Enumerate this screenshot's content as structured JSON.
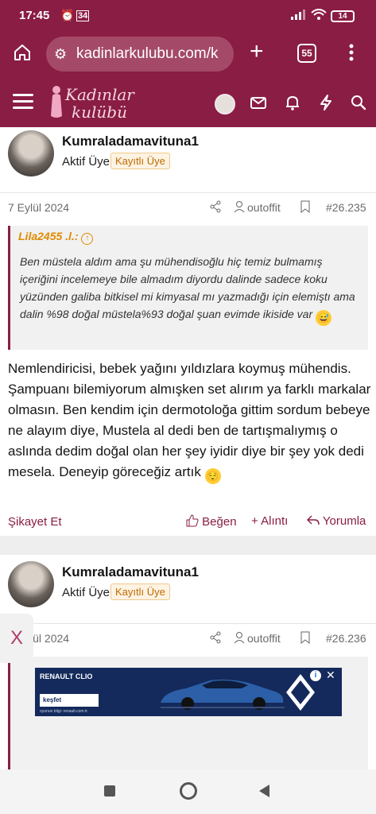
{
  "status_bar": {
    "time": "17:45",
    "battery": "14"
  },
  "browser": {
    "url": "kadinlarkulubu.com/k",
    "tab_count": "55"
  },
  "site": {
    "logo_line1": "Kadınlar",
    "logo_line2": "kulübü"
  },
  "posts": [
    {
      "username": "Kumraladamavituna1",
      "role": "Aktif Üye",
      "badge": "Kayıtlı Üye",
      "date": "7 Eylül 2024",
      "author_link": "outoffit",
      "post_number": "#26.235",
      "quote_author": "Lila2455 .l.:",
      "quote_text": "Ben müstela aldım ama şu mühendisoğlu hiç temiz bulmamış içeriğini incelemeye bile almadım diyordu dalinde sadece koku yüzünden galiba bitkisel mi kimyasal mı yazmadığı için elemiştı ama dalin %98 doğal müstela%93 doğal şuan evimde ikiside var",
      "body": "Nemlendiricisi, bebek yağını yıldızlara koymuş mühendis. Şampuanı bilemiyorum almışken set alırım ya farklı markalar olmasın. Ben kendim için dermotoloğa gittim sordum bebeye ne alayım diye, Mustela al dedi ben de tartışmalıymış o aslında dedim doğal olan her şey iyidir diye bir şey yok dedi mesela. Deneyip göreceğiz artık",
      "actions": {
        "report": "Şikayet Et",
        "like": "Beğen",
        "quote": "Alıntı",
        "reply": "Yorumla"
      }
    },
    {
      "username": "Kumraladamavituna1",
      "role": "Aktif Üye",
      "badge": "Kayıtlı Üye",
      "date": "7 Eylül 2024",
      "author_link": "outoffit",
      "post_number": "#26.236"
    }
  ],
  "ad": {
    "brand": "RENAULT CLIO",
    "cta": "keşfet",
    "small_print": "oyunun bilgi: renault.com.tr",
    "close_label": "X"
  },
  "colors": {
    "brand": "#8a1d43",
    "badge": "#c06a00",
    "quote_author": "#e08a00"
  }
}
